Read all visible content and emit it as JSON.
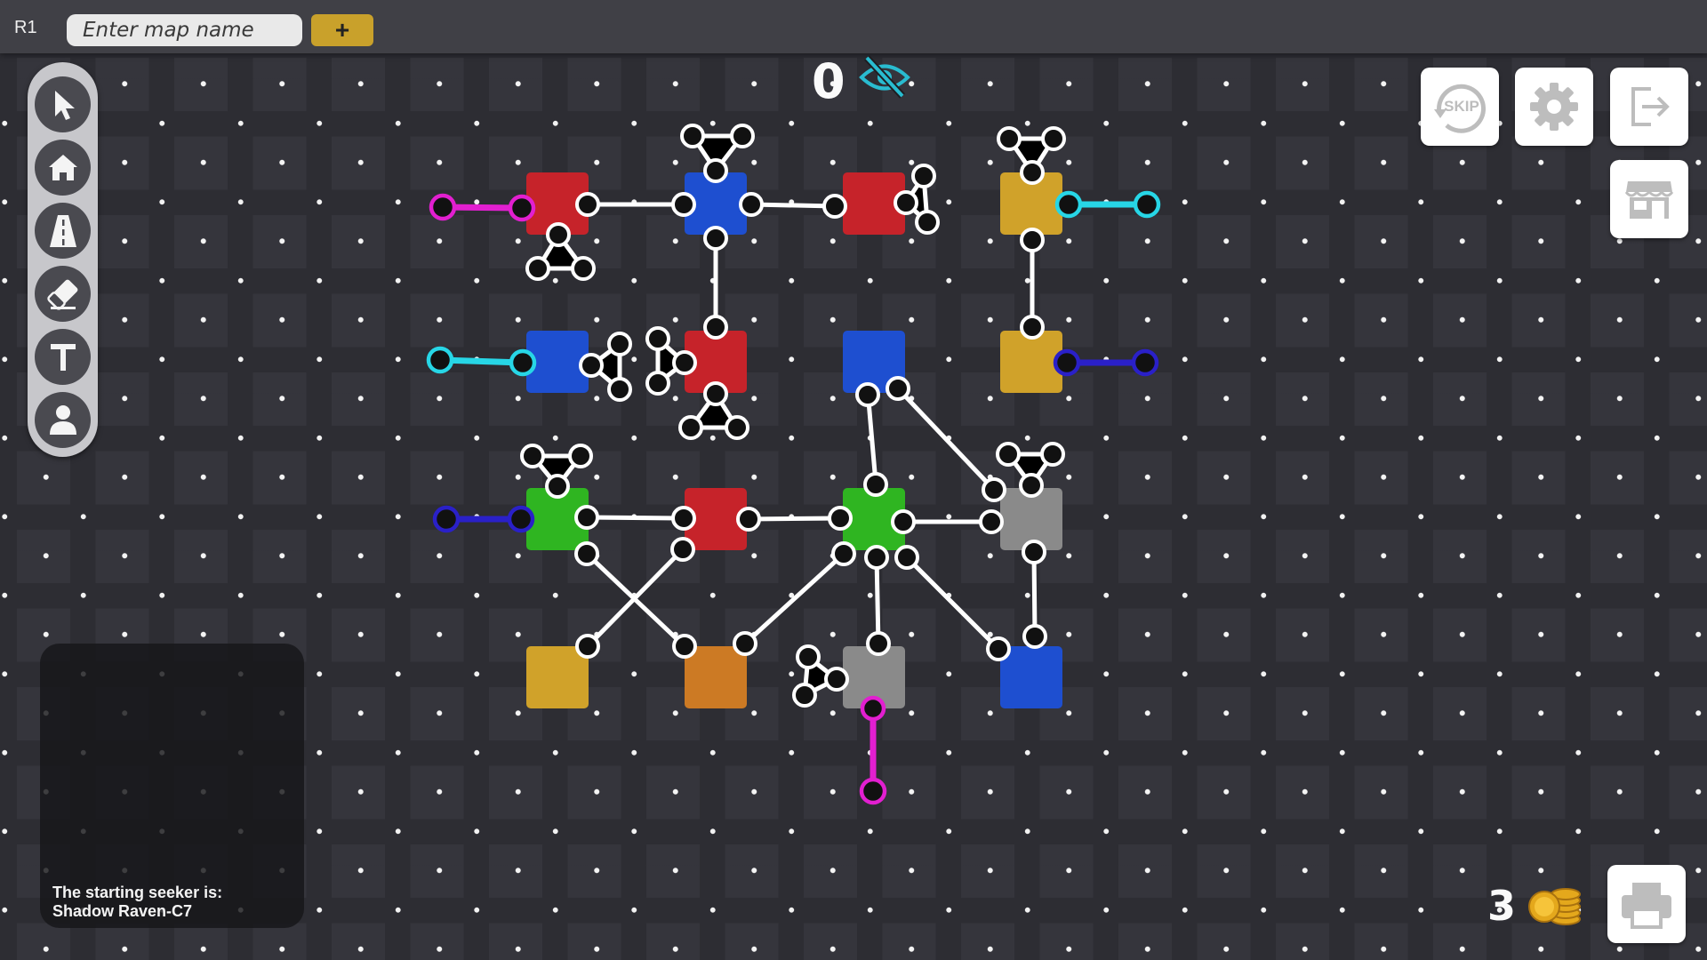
{
  "header": {
    "round_label": "R1",
    "map_name_placeholder": "Enter map name",
    "add_label": "+"
  },
  "toolbar": {
    "tools": [
      "pointer-icon",
      "home-icon",
      "road-icon",
      "eraser-icon",
      "text-icon",
      "person-icon"
    ]
  },
  "hud": {
    "visibility_count": "0",
    "coins": "3"
  },
  "buttons": [
    "skip-button",
    "settings-button",
    "exit-button",
    "shop-button",
    "save-button"
  ],
  "skip_label": "SKIP",
  "info": {
    "line1": "The starting seeker is:",
    "line2": "Shadow Raven-C7"
  },
  "colors": {
    "red": "#c6232a",
    "blue": "#1e4fd0",
    "gold": "#d0a22a",
    "green": "#2fb521",
    "gray": "#8a8a8a",
    "orange": "#cc7a24",
    "magenta": "#e21fd0",
    "cyan": "#27d6e6",
    "indigo": "#2a20c8"
  }
}
